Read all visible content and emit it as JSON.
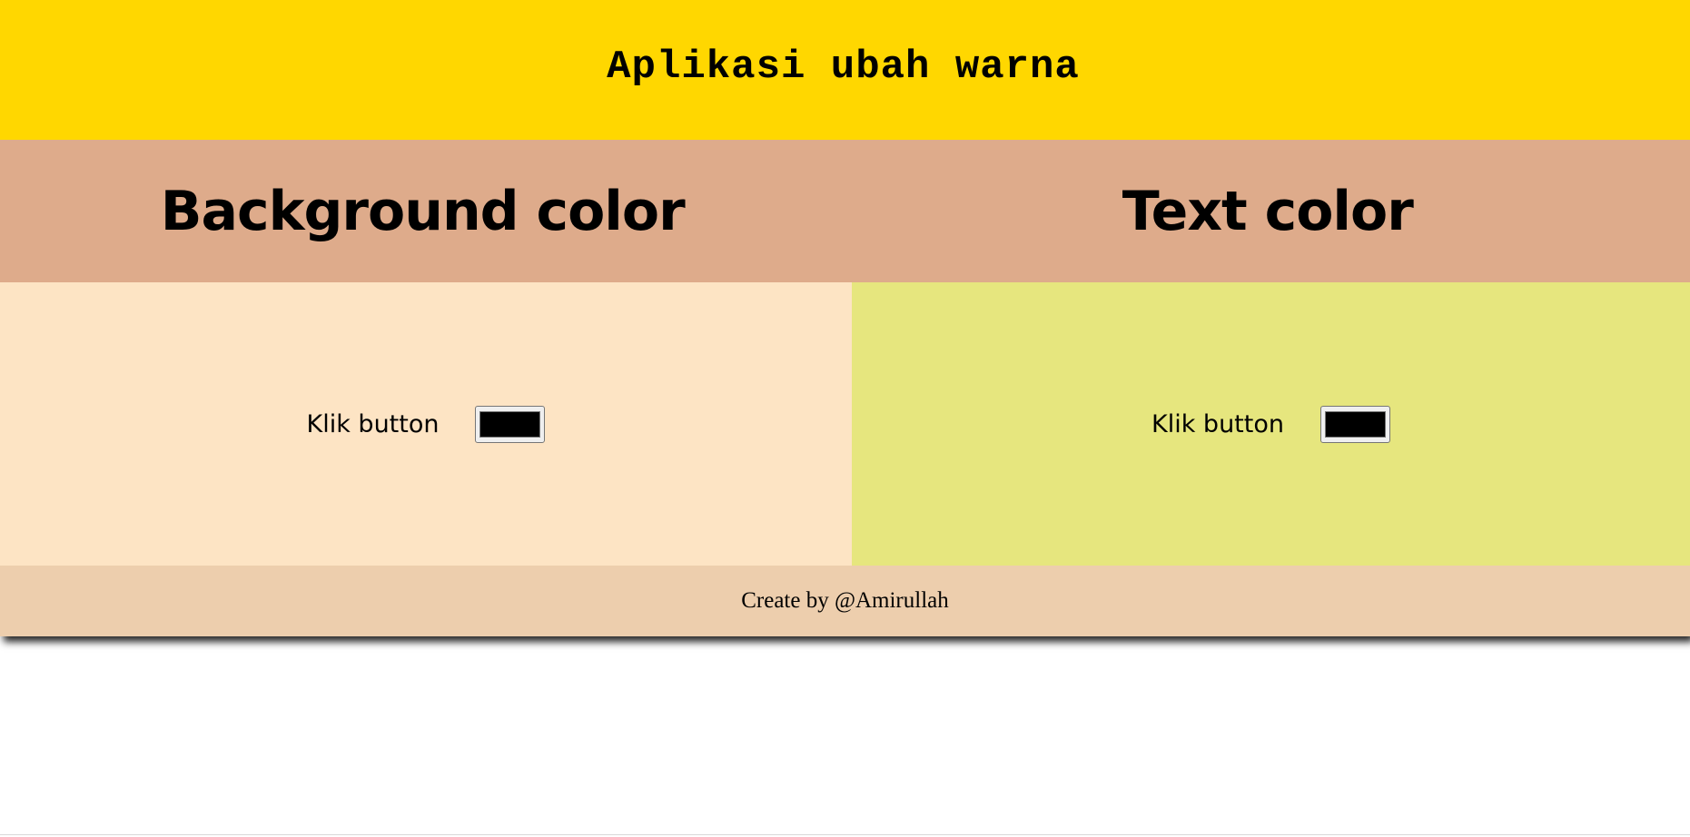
{
  "header": {
    "title": "Aplikasi ubah warna"
  },
  "sections": {
    "background": {
      "title": "Background color",
      "label": "Klik button",
      "picker_value": "#000000"
    },
    "text": {
      "title": "Text color",
      "label": "Klik button",
      "picker_value": "#000000"
    }
  },
  "footer": {
    "credit": "Create by @Amirullah"
  },
  "colors": {
    "header_bg": "#FFD700",
    "titles_bg": "#DEAB8B",
    "left_panel_bg": "#FDE4C4",
    "right_panel_bg": "#E6E67E",
    "footer_bg": "#EDCEAD",
    "swatch": "#000000"
  }
}
